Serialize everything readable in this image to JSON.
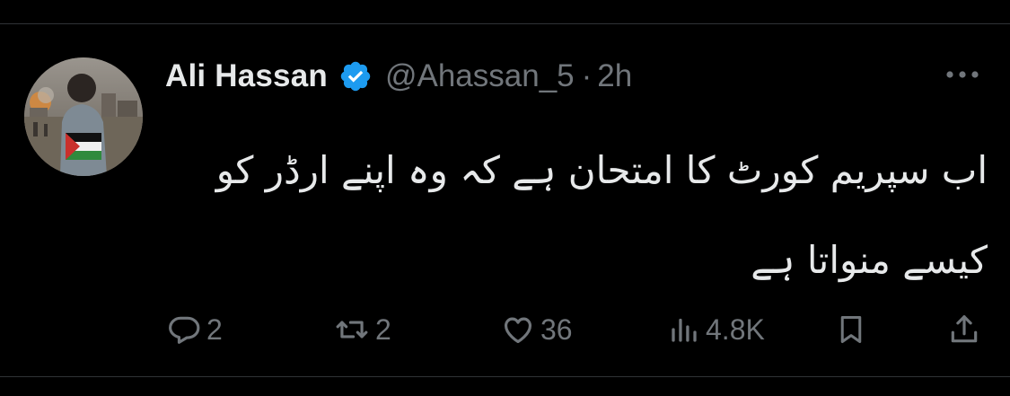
{
  "tweet": {
    "author": {
      "display_name": "Ali Hassan",
      "handle": "@Ahassan_5",
      "verified": true
    },
    "separator": "·",
    "time": "2h",
    "text": "اب سپریم کورٹ کا امتحان ہے کہ وہ اپنے ارڈر کو کیسے منواتا ہے",
    "actions": {
      "replies": "2",
      "reposts": "2",
      "likes": "36",
      "views": "4.8K"
    }
  },
  "icons": {
    "avatar": "avatar-photo",
    "verified": "verified-badge-icon",
    "more": "more-options-icon",
    "reply": "reply-icon",
    "repost": "repost-icon",
    "like": "heart-icon",
    "views": "views-chart-icon",
    "bookmark": "bookmark-icon",
    "share": "share-icon"
  },
  "colors": {
    "background": "#000000",
    "text": "#e7e9ea",
    "muted": "#71767b",
    "verified": "#1d9bf0",
    "divider": "#2f3336"
  }
}
